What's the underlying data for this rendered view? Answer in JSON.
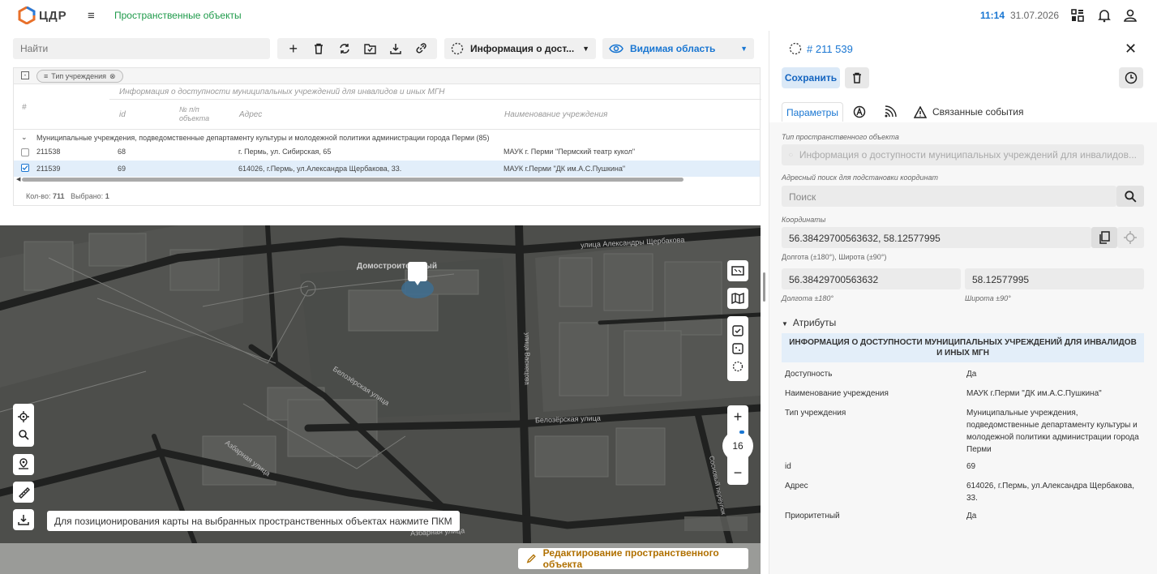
{
  "header": {
    "logo_text": "ЦДР",
    "breadcrumb": "Пространственные объекты",
    "time": "11:14",
    "date": "31.07.2026"
  },
  "toolbar": {
    "search_placeholder": "Найти",
    "layer_select": "Информация о дост...",
    "view_select": "Видимая область"
  },
  "grid": {
    "filter_chip": "Тип учреждения",
    "group_header": "Информация о доступности муниципальных учреждений для инвалидов и иных МГН",
    "columns": [
      "#",
      "id",
      "№ п/п объекта",
      "Адрес",
      "Наименование учреждения"
    ],
    "col_num_1": "№ п/п",
    "col_num_2": "объекта",
    "group_row": "Муниципальные учреждения, подведомственные департаменту культуры и молодежной политики администрации города Перми (85)",
    "rows": [
      {
        "id": "211538",
        "num": "68",
        "address": "г. Пермь, ул. Сибирская, 65",
        "name": "МАУК г. Перми \"Пермский театр кукол\"",
        "checked": false
      },
      {
        "id": "211539",
        "num": "69",
        "address": "614026, г.Пермь, ул.Александра Щербакова, 33.",
        "name": "МАУК г.Перми \"ДК им.А.С.Пушкина\"",
        "checked": true
      }
    ],
    "count_label": "Кол-во:",
    "count_value": "711",
    "selected_label": "Выбрано:",
    "selected_value": "1"
  },
  "map": {
    "street_1": "улица Александры Щербакова",
    "street_2": "Белозёрская улица",
    "street_3": "Белозёрская улица",
    "street_4": "Азбарная улица",
    "street_5": "Азбарная улица",
    "street_6": "улица Васнецова",
    "street_7": "Сосновый переулок",
    "place_label": "Домостроительный",
    "zoom": "16",
    "hint": "Для позиционирования карты на выбранных пространственных объектах нажмите ПКМ",
    "edit_button": "Редактирование пространственного объекта"
  },
  "panel": {
    "object_id": "# 211 539",
    "save_label": "Сохранить",
    "tab_params": "Параметры",
    "tab_events": "Связанные события",
    "type_label": "Тип пространственного объекта",
    "type_value": "Информация о доступности муниципальных учреждений для инвалидов...",
    "addr_search_label": "Адресный поиск для подстановки координат",
    "addr_search_placeholder": "Поиск",
    "coords_label": "Координаты",
    "coords_value": "56.38429700563632, 58.12577995",
    "coords_hint": "Долгота (±180°), Широта (±90°)",
    "lon_value": "56.38429700563632",
    "lat_value": "58.12577995",
    "lon_label": "Долгота ±180°",
    "lat_label": "Широта ±90°",
    "attrs_title": "Атрибуты",
    "attrs_header": "ИНФОРМАЦИЯ О ДОСТУПНОСТИ МУНИЦИПАЛЬНЫХ УЧРЕЖДЕНИЙ ДЛЯ ИНВАЛИДОВ И ИНЫХ МГН",
    "attrs": [
      {
        "k": "Доступность",
        "v": "Да"
      },
      {
        "k": "Наименование учреждения",
        "v": "МАУК г.Перми \"ДК им.А.С.Пушкина\""
      },
      {
        "k": "Тип учреждения",
        "v": "Муниципальные учреждения, подведомственные департаменту культуры и молодежной политики администрации города Перми"
      },
      {
        "k": "id",
        "v": "69"
      },
      {
        "k": "Адрес",
        "v": "614026, г.Пермь, ул.Александра Щербакова, 33."
      },
      {
        "k": "Приоритетный",
        "v": "Да"
      }
    ]
  },
  "colors": {
    "accent": "#1976d2",
    "brand_green": "#1e9a4a",
    "edit": "#b07000"
  }
}
